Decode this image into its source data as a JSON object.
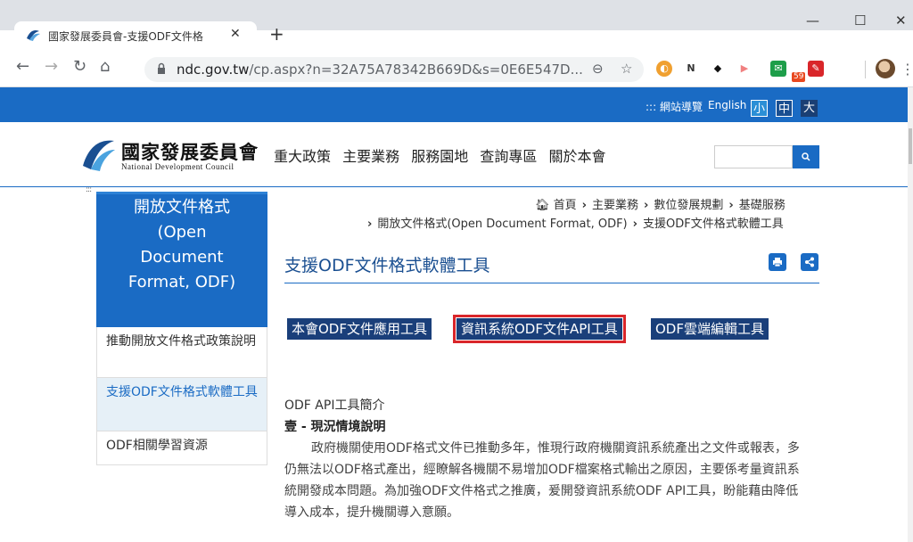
{
  "browser": {
    "tab_title": "國家發展委員會-支援ODF文件格",
    "url_host": "ndc.gov.tw",
    "url_path": "/cp.aspx?n=32A75A78342B669D&s=0E6E547D...",
    "badge_count": "59"
  },
  "topbar": {
    "sitemap": ":::  網站導覽",
    "english": "English",
    "font_small": "小",
    "font_mid": "中",
    "font_big": "大"
  },
  "header": {
    "logo_cn": "國家發展委員會",
    "logo_en": "National Development Council",
    "nav": [
      "重大政策",
      "主要業務",
      "服務園地",
      "查詢專區",
      "關於本會"
    ]
  },
  "sidebar": {
    "dots": ":::",
    "heading_lines": [
      "開放文件格式",
      "(Open",
      "Document",
      "Format, ODF)"
    ],
    "items": [
      {
        "label": "推動開放文件格式政策說明"
      },
      {
        "label": "支援ODF文件格式軟體工具"
      },
      {
        "label": "ODF相關學習資源"
      }
    ]
  },
  "breadcrumb": {
    "home": "首頁",
    "l1": "主要業務",
    "l2": "數位發展規劃",
    "l3": "基礎服務",
    "l4": "開放文件格式(Open Document Format, ODF)",
    "l5": "支援ODF文件格式軟體工具"
  },
  "content": {
    "title": "支援ODF文件格式軟體工具",
    "buttons": [
      {
        "label": "本會ODF文件應用工具"
      },
      {
        "label": "資訊系統ODF文件API工具"
      },
      {
        "label": "ODF雲端編輯工具"
      }
    ],
    "section_title": "ODF API工具簡介",
    "section_sub": "壹 - 現況情境說明",
    "paragraph": "政府機關使用ODF格式文件已推動多年，惟現行政府機關資訊系統產出之文件或報表，多仍無法以ODF格式產出，經瞭解各機關不易增加ODF檔案格式輸出之原因，主要係考量資訊系統開發成本問題。為加強ODF文件格式之推廣，爰開發資訊系統ODF API工具，盼能藉由降低導入成本，提升機關導入意願。"
  },
  "colors": {
    "brand_blue": "#1a6bc4",
    "dark_navy": "#1a3f7a",
    "highlight_red": "#d9262a"
  }
}
